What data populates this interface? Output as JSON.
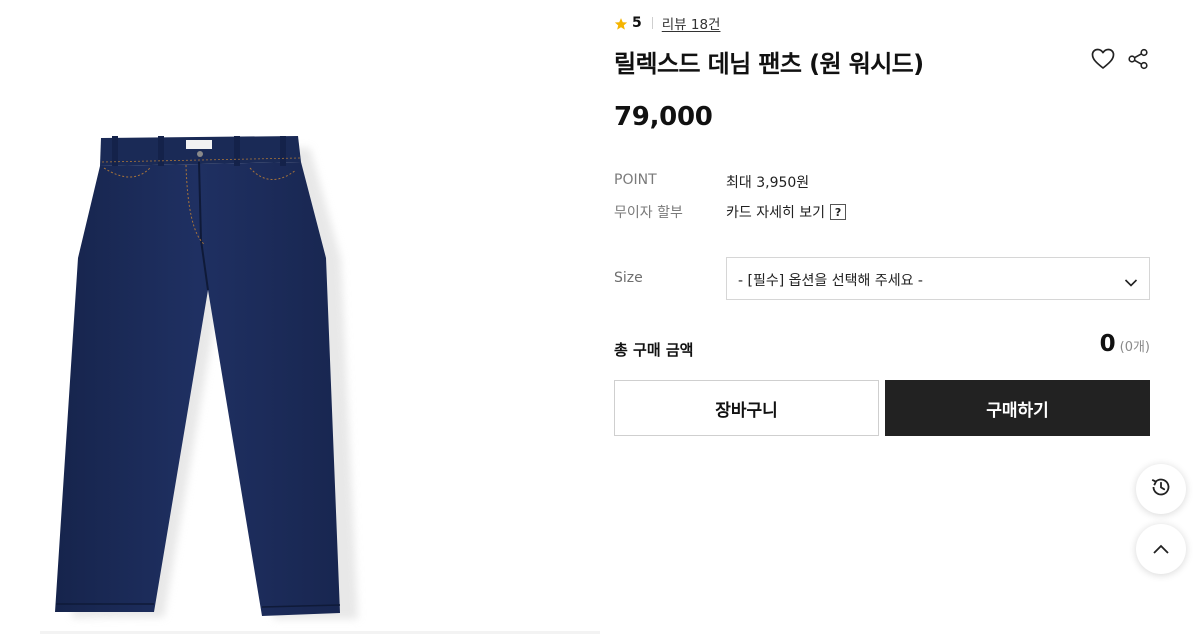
{
  "product": {
    "rating": "5",
    "review_link": "리뷰 18건",
    "title": "릴렉스드 데님 팬츠 (원 워시드)",
    "price": "79,000",
    "image_alt": "denim-pants-photo",
    "point_label": "POINT",
    "point_value": "최대 3,950원",
    "installment_label": "무이자 할부",
    "installment_value": "카드 자세히 보기",
    "help_glyph": "?"
  },
  "options": {
    "size_label": "Size",
    "size_placeholder": "- [필수] 옵션을 선택해 주세요 -"
  },
  "summary": {
    "total_label": "총 구매 금액",
    "total_amount": "0",
    "total_count": "(0개)"
  },
  "buttons": {
    "cart": "장바구니",
    "buy": "구매하기"
  },
  "icons": {
    "star": "star-icon",
    "wish": "heart-icon",
    "share": "share-icon",
    "history": "history-icon",
    "top": "chevron-up-icon",
    "select": "chevron-down-icon"
  },
  "colors": {
    "star": "#f5b400",
    "denim": "#1b2b57",
    "stitch": "#b07a3a",
    "buy_button": "#222222"
  }
}
